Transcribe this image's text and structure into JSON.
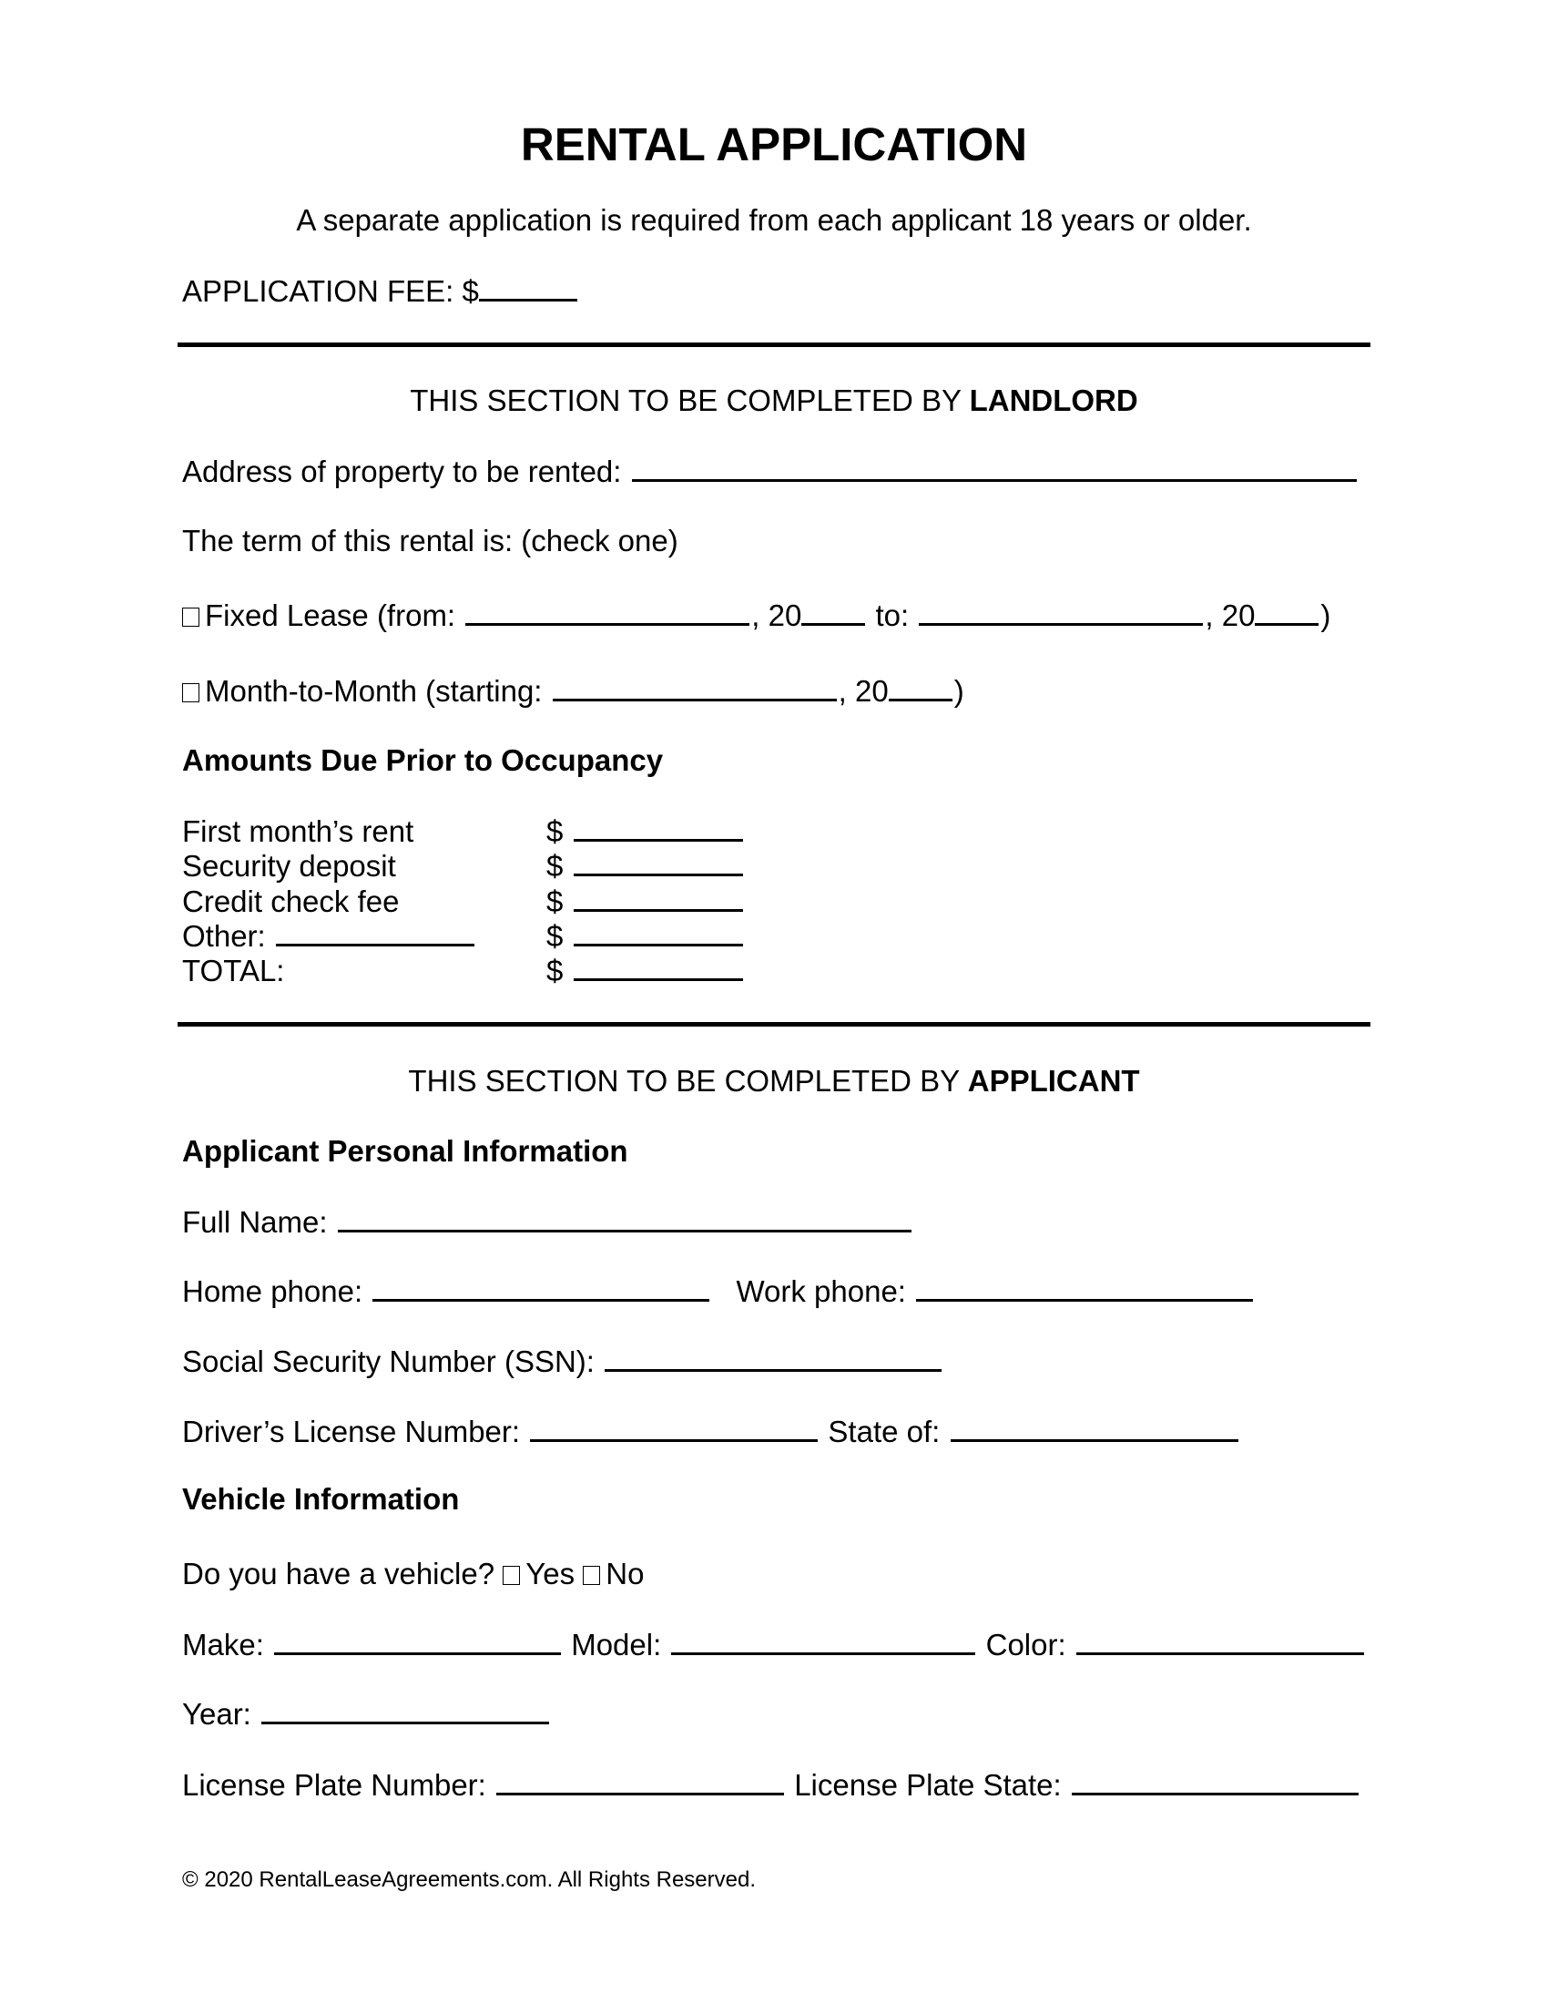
{
  "header": {
    "title": "RENTAL APPLICATION",
    "subtitle": "A separate application is required from each applicant 18 years or older.",
    "fee_label": "APPLICATION FEE: $"
  },
  "landlord": {
    "section_prefix": "THIS SECTION TO BE COMPLETED BY ",
    "section_bold": "LANDLORD",
    "address_label": "Address of property to be rented:",
    "term_label": "The term of this rental is: (check one)",
    "fixed": {
      "label": "Fixed Lease (from:",
      "year1": ", 20",
      "to": "to:",
      "year2": ", 20",
      "close": ")"
    },
    "monthly": {
      "label": "Month-to-Month (starting:",
      "year": ", 20",
      "close": ")"
    },
    "amounts_heading": "Amounts Due Prior to Occupancy",
    "amounts": [
      {
        "label": "First month’s rent",
        "currency": "$"
      },
      {
        "label": "Security deposit",
        "currency": "$"
      },
      {
        "label": "Credit check fee",
        "currency": "$"
      },
      {
        "label": "Other:",
        "currency": "$"
      },
      {
        "label": "TOTAL:",
        "currency": "$"
      }
    ]
  },
  "applicant": {
    "section_prefix": "THIS SECTION TO BE COMPLETED BY ",
    "section_bold": "APPLICANT",
    "personal_heading": "Applicant Personal Information",
    "full_name": "Full Name:",
    "home_phone": "Home phone:",
    "work_phone": "Work phone:",
    "ssn": "Social Security Number (SSN):",
    "dl_number": "Driver’s License Number:",
    "dl_state": "State of:",
    "vehicle_heading": "Vehicle Information",
    "vehicle_question": "Do you have a vehicle?",
    "yes": "Yes",
    "no": "No",
    "make": "Make:",
    "model": "Model:",
    "color": "Color:",
    "year": "Year:",
    "plate_number": "License Plate Number:",
    "plate_state": "License Plate State:"
  },
  "footer": {
    "copyright": "© 2020 RentalLeaseAgreements.com. All Rights Reserved."
  }
}
